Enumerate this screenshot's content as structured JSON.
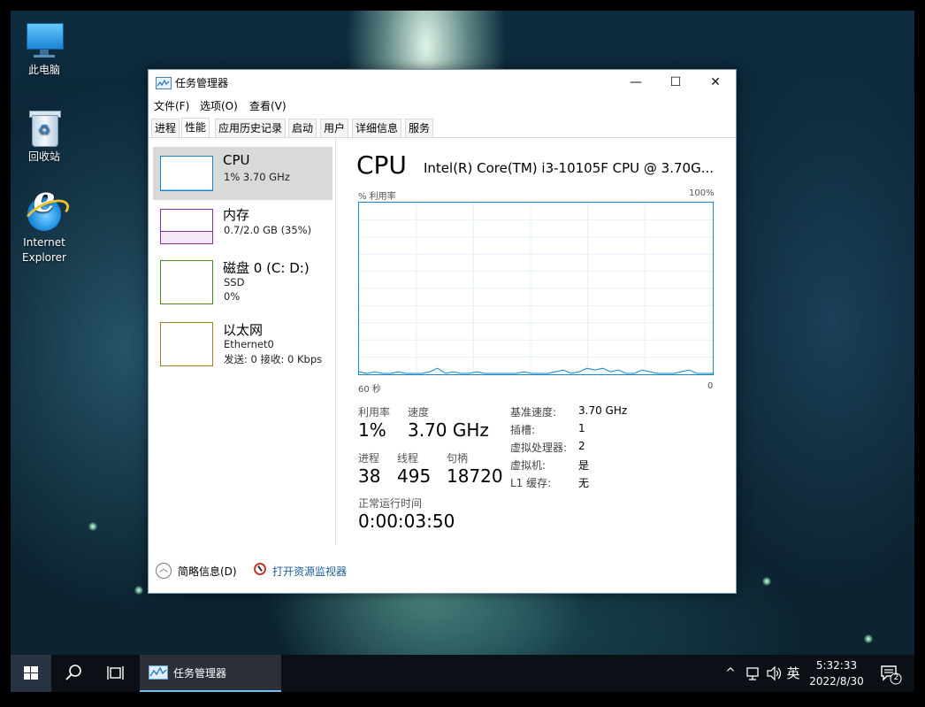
{
  "desktop": {
    "icons": [
      {
        "label": "此电脑",
        "icon": "computer-icon"
      },
      {
        "label": "回收站",
        "icon": "recycle-bin-icon"
      },
      {
        "label_line1": "Internet",
        "label_line2": "Explorer",
        "icon": "internet-explorer-icon"
      }
    ]
  },
  "window": {
    "title": "任务管理器",
    "controls": {
      "minimize": "—",
      "maximize": "☐",
      "close": "✕"
    },
    "menu": [
      "文件(F)",
      "选项(O)",
      "查看(V)"
    ],
    "tabs": [
      "进程",
      "性能",
      "应用历史记录",
      "启动",
      "用户",
      "详细信息",
      "服务"
    ],
    "active_tab": "性能",
    "resources": [
      {
        "name": "CPU",
        "line2": "1% 3.70 GHz",
        "line3": "",
        "color": "#1786c7",
        "selected": true
      },
      {
        "name": "内存",
        "line2": "0.7/2.0 GB (35%)",
        "line3": "",
        "color": "#8b2fa0",
        "selected": false
      },
      {
        "name": "磁盘 0 (C: D:)",
        "line2": "SSD",
        "line3": "0%",
        "color": "#4d8a1c",
        "selected": false
      },
      {
        "name": "以太网",
        "line2": "Ethernet0",
        "line3": "发送: 0 接收: 0 Kbps",
        "color": "#a87a2a",
        "selected": false
      }
    ],
    "cpu": {
      "title": "CPU",
      "model": "Intel(R) Core(TM) i3-10105F CPU @ 3.70G...",
      "graph_y_label": "% 利用率",
      "graph_y_max": "100%",
      "graph_x_left": "60 秒",
      "graph_x_right": "0",
      "utilization_series": [
        1,
        0,
        1,
        0,
        0,
        1,
        0,
        0,
        0,
        1,
        3,
        0,
        1,
        0,
        0,
        1,
        0,
        0,
        0,
        0,
        0,
        1,
        0,
        0,
        0,
        1,
        2,
        0,
        1,
        3,
        2,
        3,
        1,
        2,
        0,
        0,
        2,
        1,
        0,
        0,
        0,
        1,
        2,
        0,
        0,
        0
      ],
      "stats": {
        "util_label": "利用率",
        "util_value": "1%",
        "speed_label": "速度",
        "speed_value": "3.70 GHz",
        "proc_label": "进程",
        "proc_value": "38",
        "threads_label": "线程",
        "threads_value": "495",
        "handles_label": "句柄",
        "handles_value": "18720",
        "uptime_label": "正常运行时间",
        "uptime_value": "0:00:03:50"
      },
      "specs": [
        {
          "label": "基准速度:",
          "value": "3.70 GHz"
        },
        {
          "label": "插槽:",
          "value": "1"
        },
        {
          "label": "虚拟处理器:",
          "value": "2"
        },
        {
          "label": "虚拟机:",
          "value": "是"
        },
        {
          "label": "L1 缓存:",
          "value": "无"
        }
      ]
    },
    "footer": {
      "summary": "简略信息(D)",
      "resmon": "打开资源监视器"
    }
  },
  "taskbar": {
    "app_label": "任务管理器",
    "ime": "英",
    "time": "5:32:33",
    "date": "2022/8/30",
    "notification_count": "2"
  }
}
